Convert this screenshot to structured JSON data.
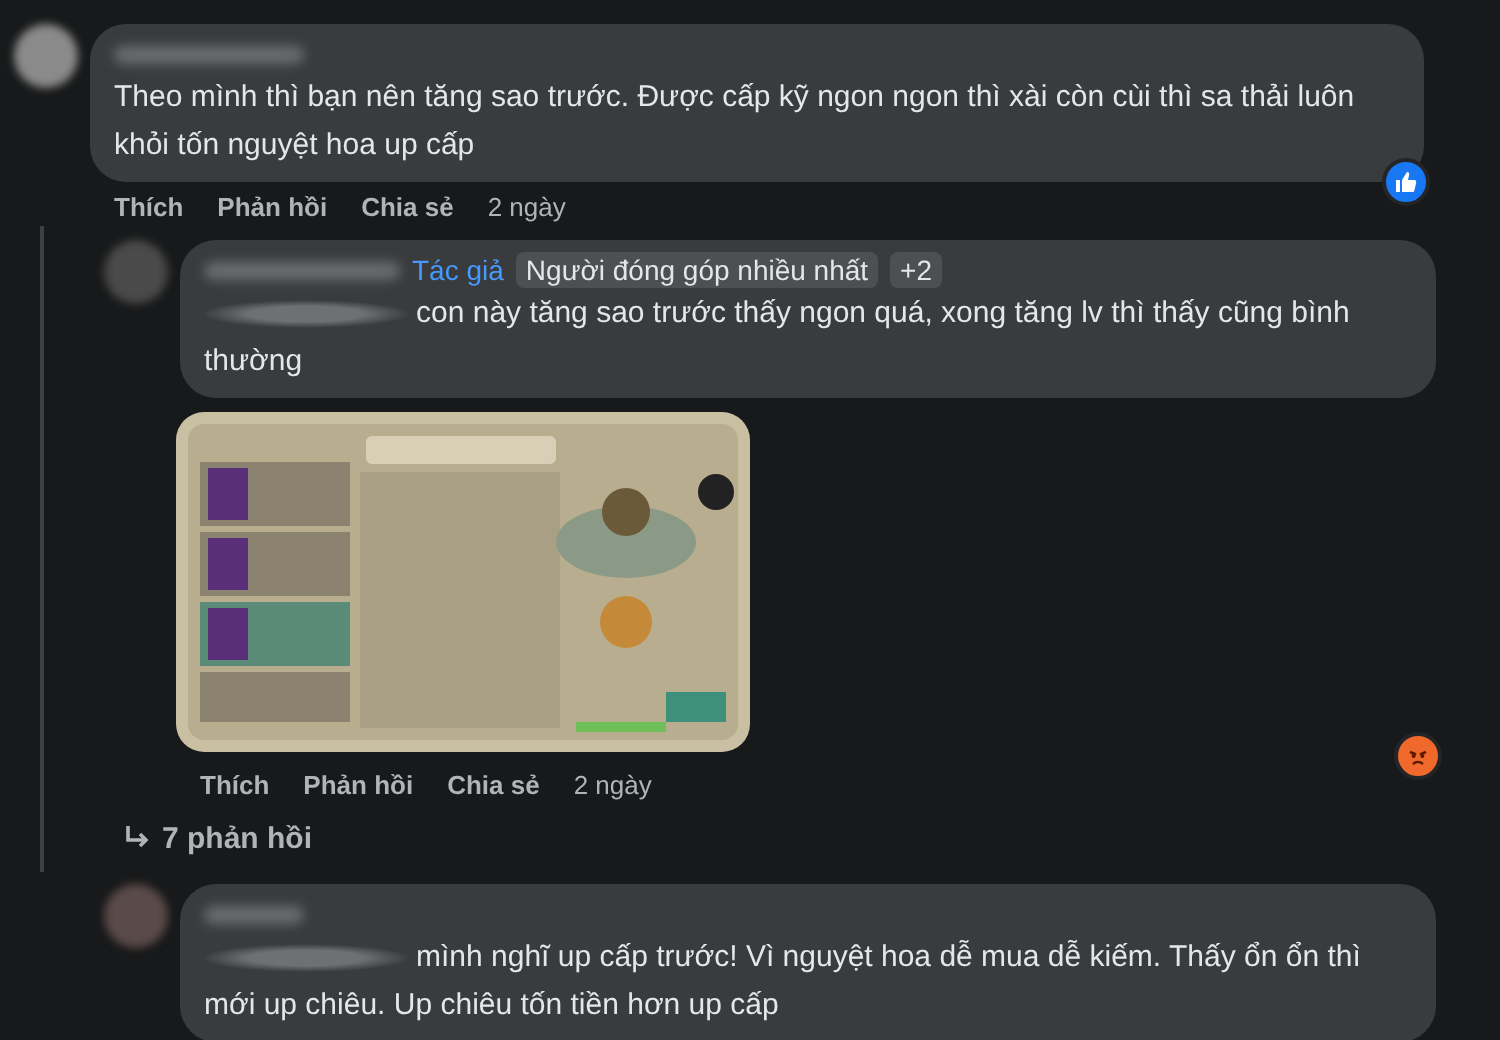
{
  "comments": [
    {
      "text": "Theo mình thì bạn nên tăng sao trước. Được cấp kỹ ngon ngon thì xài còn cùi thì sa thải luôn khỏi tốn nguyệt hoa up cấp",
      "mention": false,
      "indent": false,
      "reaction": {
        "kind": "like"
      },
      "actions": [
        "Thích",
        "Phản hồi",
        "Chia sẻ",
        "2 ngày"
      ],
      "replies": [
        {
          "badges": [
            {
              "label": "Tác giả",
              "kind": "author"
            },
            {
              "label": "Người đóng góp nhiều nhất",
              "kind": "chip"
            },
            {
              "label": "+2",
              "kind": "chip"
            }
          ],
          "mention": true,
          "text": "con này tăng sao trước thấy ngon quá, xong tăng lv thì thấy cũng bình thường",
          "attachment": {
            "kind": "picture"
          },
          "reaction": {
            "kind": "angry"
          },
          "actions": [
            "Thích",
            "Phản hồi",
            "Chia sẻ",
            "2 ngày"
          ]
        }
      ],
      "more_replies": "7 phản hồi"
    },
    {
      "text": "mình nghĩ up cấp trước! Vì nguyệt hoa dễ mua dễ kiếm. Thấy ổn ổn thì mới up chiêu. Up chiêu tốn tiền hơn up cấp",
      "mention": true,
      "indent": true
    }
  ]
}
